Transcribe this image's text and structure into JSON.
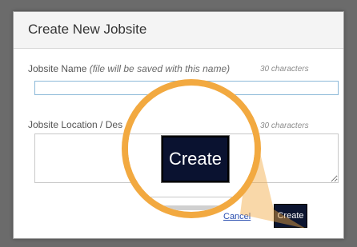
{
  "dialog": {
    "title": "Create New Jobsite",
    "name_label": "Jobsite Name",
    "name_hint": "(file will be saved with this name)",
    "name_char_limit": "30 characters",
    "name_value": "",
    "location_label": "Jobsite Location / Des",
    "location_char_limit": "30 characters",
    "location_value": "",
    "cancel_label": "Cancel",
    "create_label": "Create"
  },
  "zoom_callout": {
    "create_label": "Create",
    "accent_color": "#f2a940"
  }
}
